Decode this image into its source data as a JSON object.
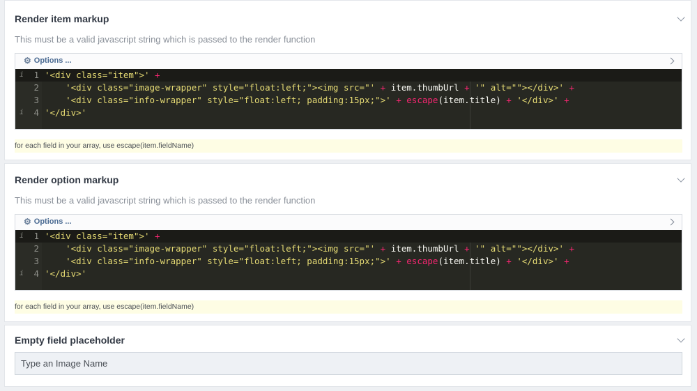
{
  "sections": [
    {
      "title": "Render item markup",
      "description": "This must be a valid javascript string which is passed to the render function",
      "options_label": "Options ...",
      "code_lines": [
        {
          "num": "1",
          "info": true,
          "tokens": [
            {
              "t": "str",
              "v": "'<div class=\"item\">'"
            },
            {
              "t": "op",
              "v": " + "
            }
          ]
        },
        {
          "num": "2",
          "info": false,
          "tokens": [
            {
              "t": "id",
              "v": "    "
            },
            {
              "t": "str",
              "v": "'<div class=\"image-wrapper\" style=\"float:left;\"><img src=\"'"
            },
            {
              "t": "op",
              "v": " + "
            },
            {
              "t": "id",
              "v": "item.thumbUrl"
            },
            {
              "t": "op",
              "v": " + "
            },
            {
              "t": "str",
              "v": "'\" alt=\"\"></div>'"
            },
            {
              "t": "op",
              "v": " +"
            }
          ]
        },
        {
          "num": "3",
          "info": false,
          "tokens": [
            {
              "t": "id",
              "v": "    "
            },
            {
              "t": "str",
              "v": "'<div class=\"info-wrapper\" style=\"float:left; padding:15px;\">'"
            },
            {
              "t": "op",
              "v": " + "
            },
            {
              "t": "fn",
              "v": "escape"
            },
            {
              "t": "id",
              "v": "(item.title)"
            },
            {
              "t": "op",
              "v": " + "
            },
            {
              "t": "str",
              "v": "'</div>'"
            },
            {
              "t": "op",
              "v": " +"
            }
          ]
        },
        {
          "num": "4",
          "info": true,
          "tokens": [
            {
              "t": "str",
              "v": "'</div>'"
            }
          ]
        }
      ],
      "hint": "for each field in your array, use escape(item.fieldName)"
    },
    {
      "title": "Render option markup",
      "description": "This must be a valid javascript string which is passed to the render function",
      "options_label": "Options ...",
      "code_lines": [
        {
          "num": "1",
          "info": true,
          "tokens": [
            {
              "t": "str",
              "v": "'<div class=\"item\">'"
            },
            {
              "t": "op",
              "v": " + "
            }
          ]
        },
        {
          "num": "2",
          "info": false,
          "tokens": [
            {
              "t": "id",
              "v": "    "
            },
            {
              "t": "str",
              "v": "'<div class=\"image-wrapper\" style=\"float:left;\"><img src=\"'"
            },
            {
              "t": "op",
              "v": " + "
            },
            {
              "t": "id",
              "v": "item.thumbUrl"
            },
            {
              "t": "op",
              "v": " + "
            },
            {
              "t": "str",
              "v": "'\" alt=\"\"></div>'"
            },
            {
              "t": "op",
              "v": " +"
            }
          ]
        },
        {
          "num": "3",
          "info": false,
          "tokens": [
            {
              "t": "id",
              "v": "    "
            },
            {
              "t": "str",
              "v": "'<div class=\"info-wrapper\" style=\"float:left; padding:15px;\">'"
            },
            {
              "t": "op",
              "v": " + "
            },
            {
              "t": "fn",
              "v": "escape"
            },
            {
              "t": "id",
              "v": "(item.title)"
            },
            {
              "t": "op",
              "v": " + "
            },
            {
              "t": "str",
              "v": "'</div>'"
            },
            {
              "t": "op",
              "v": " +"
            }
          ]
        },
        {
          "num": "4",
          "info": true,
          "tokens": [
            {
              "t": "str",
              "v": "'</div>'"
            }
          ]
        }
      ],
      "hint": "for each field in your array, use escape(item.fieldName)"
    }
  ],
  "placeholder_section": {
    "title": "Empty field placeholder",
    "value": "Type an Image Name"
  },
  "colors": {
    "editor_bg": "#272822",
    "string": "#e6db74",
    "operator": "#f92672",
    "hint_bg": "#fefde4",
    "options_link": "#4a6a92"
  },
  "icons": {
    "options": "gear-icon",
    "collapse": "chevron-down-icon",
    "expand_toolbar": "chevron-right-icon"
  }
}
